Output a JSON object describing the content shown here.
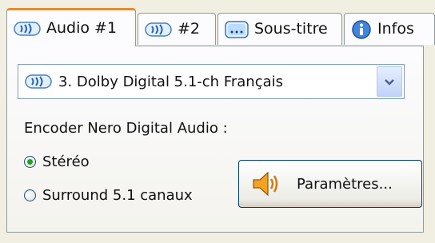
{
  "tabs": [
    {
      "label": "Audio #1",
      "icon": "audio-track-icon",
      "active": true
    },
    {
      "label": "#2",
      "icon": "audio-track-icon",
      "active": false
    },
    {
      "label": "Sous-titre",
      "icon": "subtitle-icon",
      "active": false
    },
    {
      "label": "Infos",
      "icon": "info-icon",
      "active": false
    }
  ],
  "audio_select": {
    "selected": "3. Dolby Digital 5.1-ch Français",
    "icon": "audio-track-icon"
  },
  "encoder_label": "Encoder Nero Digital Audio :",
  "radios": [
    {
      "label": "Stéréo",
      "checked": true
    },
    {
      "label": "Surround 5.1 canaux",
      "checked": false
    }
  ],
  "params_button": {
    "label": "Paramètres...",
    "icon": "speaker-icon"
  },
  "colors": {
    "active_tab_accent": "#e68b2c",
    "window_bg": "#f1efe2",
    "radio_checked": "#21a121"
  }
}
